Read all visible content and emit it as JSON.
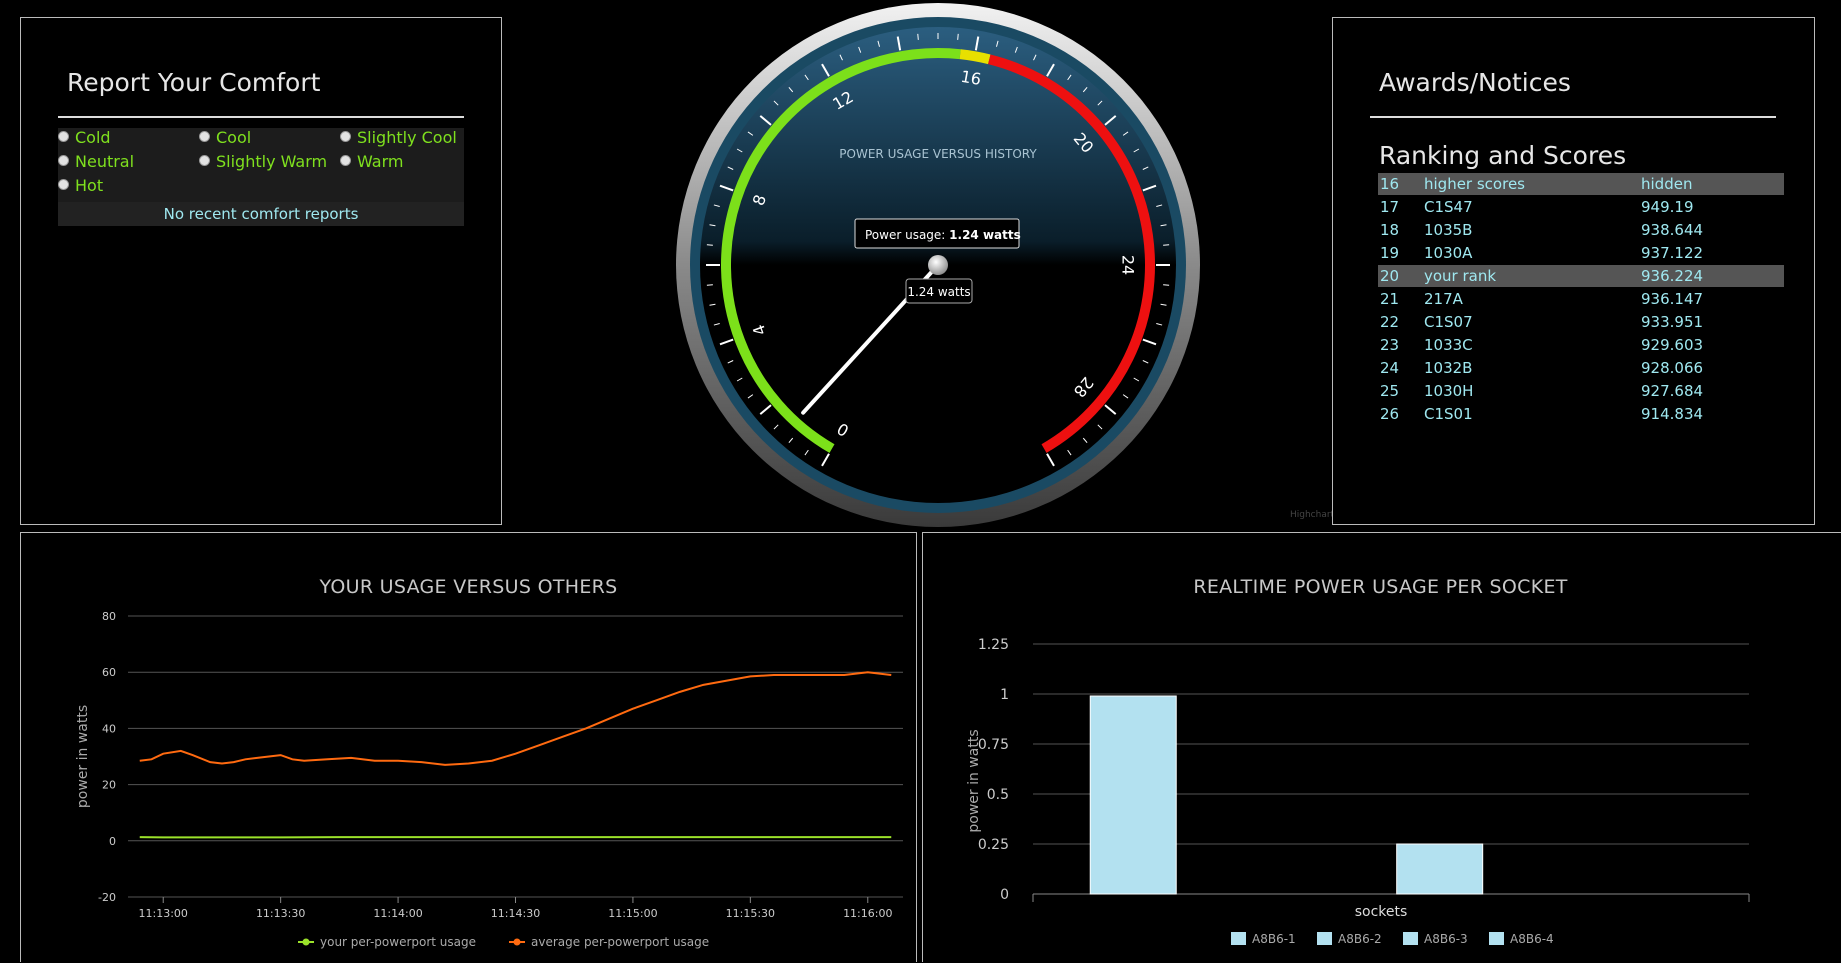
{
  "comfort": {
    "title": "Report Your Comfort",
    "options": [
      "Cold",
      "Cool",
      "Slightly Cool",
      "Neutral",
      "Slightly Warm",
      "Warm",
      "Hot"
    ],
    "no_reports": "No recent comfort reports"
  },
  "awards": {
    "title": "Awards/Notices",
    "ranking_title": "Ranking and Scores",
    "rows": [
      {
        "rank": "16",
        "name": "higher scores",
        "score": "hidden",
        "highlight": true
      },
      {
        "rank": "17",
        "name": "C1S47",
        "score": "949.19",
        "highlight": false
      },
      {
        "rank": "18",
        "name": "1035B",
        "score": "938.644",
        "highlight": false
      },
      {
        "rank": "19",
        "name": "1030A",
        "score": "937.122",
        "highlight": false
      },
      {
        "rank": "20",
        "name": "your rank",
        "score": "936.224",
        "highlight": true
      },
      {
        "rank": "21",
        "name": "217A",
        "score": "936.147",
        "highlight": false
      },
      {
        "rank": "22",
        "name": "C1S07",
        "score": "933.951",
        "highlight": false
      },
      {
        "rank": "23",
        "name": "1033C",
        "score": "929.603",
        "highlight": false
      },
      {
        "rank": "24",
        "name": "1032B",
        "score": "928.066",
        "highlight": false
      },
      {
        "rank": "25",
        "name": "1030H",
        "score": "927.684",
        "highlight": false
      },
      {
        "rank": "26",
        "name": "C1S01",
        "score": "914.834",
        "highlight": false
      }
    ]
  },
  "gauge": {
    "title": "POWER USAGE VERSUS HISTORY",
    "tooltip_label": "Power usage: ",
    "tooltip_value": "1.24 watts",
    "value_label": "1.24 watts",
    "value": 1.24,
    "min": 0,
    "max": 30,
    "tick_labels": [
      "0",
      "4",
      "8",
      "12",
      "16",
      "20",
      "24",
      "28"
    ],
    "green_band": [
      0,
      15.6
    ],
    "yellow_band": [
      15.6,
      16.4
    ],
    "red_band": [
      16.4,
      30
    ],
    "colors": {
      "green": "#7ce01a",
      "yellow": "#e8e000",
      "red": "#ee1010"
    },
    "credit": "Highcharts.com"
  },
  "chart_data": [
    {
      "type": "line",
      "title": "YOUR USAGE VERSUS OTHERS",
      "ylabel": "power in watts",
      "xlabel": "",
      "ylim": [
        -20,
        80
      ],
      "yticks": [
        "-20",
        "0",
        "20",
        "40",
        "60",
        "80"
      ],
      "xticks": [
        "11:13:00",
        "11:13:30",
        "11:14:00",
        "11:14:30",
        "11:15:00",
        "11:15:30",
        "11:16:00"
      ],
      "xlim_seconds_after_11_13": [
        -3,
        63
      ],
      "grid": true,
      "legend_position": "bottom-center",
      "series": [
        {
          "name": "your per-powerport usage",
          "color": "#9be22a",
          "x": [
            -2,
            0,
            5,
            10,
            15,
            20,
            25,
            30,
            35,
            40,
            45,
            50,
            55,
            60,
            62
          ],
          "y": [
            1.3,
            1.2,
            1.2,
            1.2,
            1.3,
            1.3,
            1.3,
            1.3,
            1.3,
            1.3,
            1.3,
            1.3,
            1.3,
            1.3,
            1.3
          ]
        },
        {
          "name": "average per-powerport usage",
          "color": "#ff6a10",
          "x": [
            -2,
            -1,
            0,
            1.5,
            2.5,
            4,
            5,
            6,
            7,
            8,
            9,
            10,
            11,
            12,
            14,
            16,
            18,
            20,
            22,
            24,
            26,
            28,
            30,
            32,
            34,
            36,
            38,
            40,
            42,
            44,
            46,
            48,
            50,
            52,
            54,
            56,
            58,
            60,
            61,
            62
          ],
          "y": [
            28.5,
            29,
            31,
            32,
            30.5,
            28,
            27.5,
            28,
            29,
            29.5,
            30,
            30.5,
            29,
            28.5,
            29,
            29.5,
            28.5,
            28.5,
            28,
            27,
            27.5,
            28.5,
            31,
            34,
            37,
            40,
            43.5,
            47,
            50,
            53,
            55.5,
            57,
            58.5,
            59,
            59,
            59,
            59,
            60,
            59.5,
            59
          ]
        }
      ]
    },
    {
      "type": "bar",
      "title": "REALTIME POWER USAGE PER SOCKET",
      "ylabel": "power in watts",
      "xlabel": "sockets",
      "ylim": [
        0,
        1.25
      ],
      "yticks": [
        "0",
        "0.25",
        "0.5",
        "0.75",
        "1",
        "1.25"
      ],
      "grid": true,
      "legend_position": "bottom-center",
      "categories": [
        "A8B6-1",
        "A8B6-2",
        "A8B6-3",
        "A8B6-4"
      ],
      "values": [
        0.99,
        0,
        0.25,
        0
      ],
      "bar_color": "#b3e1f0"
    }
  ]
}
